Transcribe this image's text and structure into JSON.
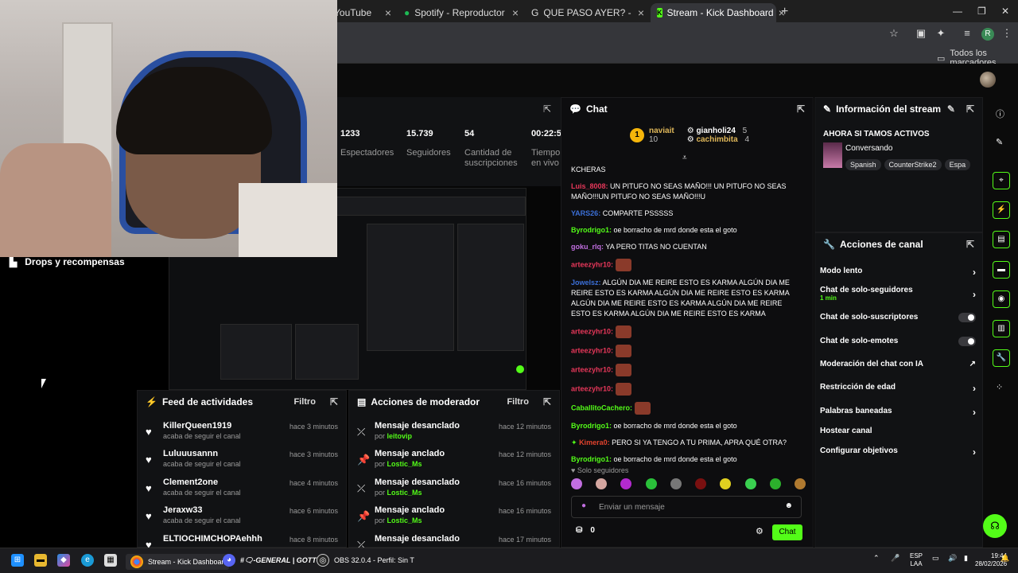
{
  "browser": {
    "tabs": [
      {
        "label": "YouTube",
        "icon": "youtube-icon"
      },
      {
        "label": "Spotify - Reproductor web: mú",
        "icon": "spotify-icon"
      },
      {
        "label": "QUE PASO AYER? - Buscar con",
        "icon": "google-icon"
      },
      {
        "label": "Stream - Kick Dashboard",
        "icon": "kick-icon"
      }
    ],
    "bookmarks_label": "Todos los marcadores",
    "profile_initial": "R"
  },
  "sidebar": {
    "drops_label": "Drops y recompensas"
  },
  "stats": {
    "items": [
      {
        "value": "1233",
        "label": "Espectadores"
      },
      {
        "value": "15.739",
        "label": "Seguidores"
      },
      {
        "value": "54",
        "label": "Cantidad de suscripciones"
      },
      {
        "value": "00:22:5",
        "label": "Tiempo en vivo"
      }
    ]
  },
  "activity": {
    "title": "Feed de actividades",
    "filter": "Filtro",
    "items": [
      {
        "name": "KillerQueen1919",
        "action": "acaba de seguir el canal",
        "time": "hace 3 minutos"
      },
      {
        "name": "Luluuusannn",
        "action": "acaba de seguir el canal",
        "time": "hace 3 minutos"
      },
      {
        "name": "Clement2one",
        "action": "acaba de seguir el canal",
        "time": "hace 4 minutos"
      },
      {
        "name": "Jeraxw33",
        "action": "acaba de seguir el canal",
        "time": "hace 6 minutos"
      },
      {
        "name": "ELTIOCHIMCHOPAehhh",
        "action": "",
        "time": "hace 8 minutos"
      }
    ]
  },
  "modactions": {
    "title": "Acciones de moderador",
    "filter": "Filtro",
    "by_prefix": "por",
    "items": [
      {
        "action": "Mensaje desanclado",
        "by": "leitovip",
        "time": "hace 12 minutos"
      },
      {
        "action": "Mensaje anclado",
        "by": "Lostic_Ms",
        "time": "hace 12 minutos"
      },
      {
        "action": "Mensaje desanclado",
        "by": "Lostic_Ms",
        "time": "hace 16 minutos"
      },
      {
        "action": "Mensaje anclado",
        "by": "Lostic_Ms",
        "time": "hace 16 minutos"
      },
      {
        "action": "Mensaje desanclado",
        "by": "",
        "time": "hace 17 minutos"
      }
    ]
  },
  "chat": {
    "title": "Chat",
    "top": [
      {
        "rank": "1",
        "name": "naviait",
        "count": "10"
      },
      {
        "rank": "",
        "name": "gianholi24",
        "count": "5"
      },
      {
        "rank": "",
        "name": "cachimbita",
        "count": "4"
      }
    ],
    "messages": [
      {
        "user": "",
        "text": "KCHERAS",
        "cls": ""
      },
      {
        "user": "Luis_8008:",
        "text": " UN PITUFO NO SEAS MAÑO!!! UN PITUFO NO SEAS MAÑO!!!UN PITUFO NO SEAS MAÑO!!!U",
        "cls": "u1"
      },
      {
        "user": "YARS26:",
        "text": " COMPARTE PSSSSS",
        "cls": "u2"
      },
      {
        "user": "Byrodrigo1:",
        "text": " oe borracho de mrd donde esta el goto",
        "cls": "u3"
      },
      {
        "user": "goku_rlq:",
        "text": " YA PERO TITAS NO CUENTAN",
        "cls": "u4"
      },
      {
        "user": "arteezyhr10:",
        "text": "",
        "cls": "u1",
        "emote": true
      },
      {
        "user": "Jowelsz:",
        "text": " ALGÚN DIA ME REIRE ESTO ES KARMA ALGÚN DIA ME REIRE ESTO ES KARMA ALGÚN DIA ME REIRE ESTO ES KARMA ALGÚN DIA ME REIRE ESTO ES KARMA ALGÚN DIA ME REIRE ESTO ES KARMA ALGÚN DIA ME REIRE ESTO ES KARMA",
        "cls": "u2"
      },
      {
        "user": "arteezyhr10:",
        "text": "",
        "cls": "u1",
        "emote": true
      },
      {
        "user": "arteezyhr10:",
        "text": "",
        "cls": "u1",
        "emote": true
      },
      {
        "user": "arteezyhr10:",
        "text": "",
        "cls": "u1",
        "emote": true
      },
      {
        "user": "arteezyhr10:",
        "text": "",
        "cls": "u1",
        "emote": true
      },
      {
        "user": "CaballitoCachero:",
        "text": "",
        "cls": "u3",
        "emote": true
      },
      {
        "user": "Byrodrigo1:",
        "text": " oe borracho de mrd donde esta el goto",
        "cls": "u3"
      },
      {
        "user": "Kimera0:",
        "text": " PERO SI YA TENGO A TU PRIMA, APRA QUÉ OTRA?",
        "cls": "u5"
      },
      {
        "user": "Byrodrigo1:",
        "text": " oe borracho de mrd donde esta el goto",
        "cls": "u3"
      }
    ],
    "mode_label": "Solo seguidores",
    "input_placeholder": "Enviar un mensaje",
    "points": "0",
    "send_label": "Chat"
  },
  "info": {
    "title": "Información del stream",
    "stream_title": "AHORA SI TAMOS ACTIVOS",
    "category": "Conversando",
    "tags": [
      "Spanish",
      "CounterStrike2",
      "Espa"
    ]
  },
  "actions": {
    "title": "Acciones de canal",
    "items": [
      {
        "label": "Modo lento",
        "sub": "",
        "control": "chevron"
      },
      {
        "label": "Chat de solo-seguidores",
        "sub": "1 min",
        "control": "chevron"
      },
      {
        "label": "Chat de solo-suscriptores",
        "sub": "",
        "control": "toggle"
      },
      {
        "label": "Chat de solo-emotes",
        "sub": "",
        "control": "toggle"
      },
      {
        "label": "Moderación del chat con IA",
        "sub": "",
        "control": "external"
      },
      {
        "label": "Restricción de edad",
        "sub": "",
        "control": "chevron"
      },
      {
        "label": "Palabras baneadas",
        "sub": "",
        "control": "chevron"
      },
      {
        "label": "Hostear canal",
        "sub": "",
        "control": "none"
      },
      {
        "label": "Configurar objetivos",
        "sub": "",
        "control": "chevron"
      }
    ]
  },
  "taskbar": {
    "apps": [
      {
        "label": "Stream - Kick Dashboar",
        "icon": "chrome-icon"
      },
      {
        "label": "#🗨-GENERAL | GOTTO",
        "icon": "discord-icon"
      },
      {
        "label": "OBS 32.0.4 - Perfil: Sin T",
        "icon": "obs-icon"
      }
    ],
    "lang_top": "ESP",
    "lang_bottom": "LAA",
    "time": "19:44",
    "date": "28/02/2026"
  },
  "colors": {
    "accent": "#53fc18",
    "panel": "#111214",
    "background": "#000000"
  }
}
